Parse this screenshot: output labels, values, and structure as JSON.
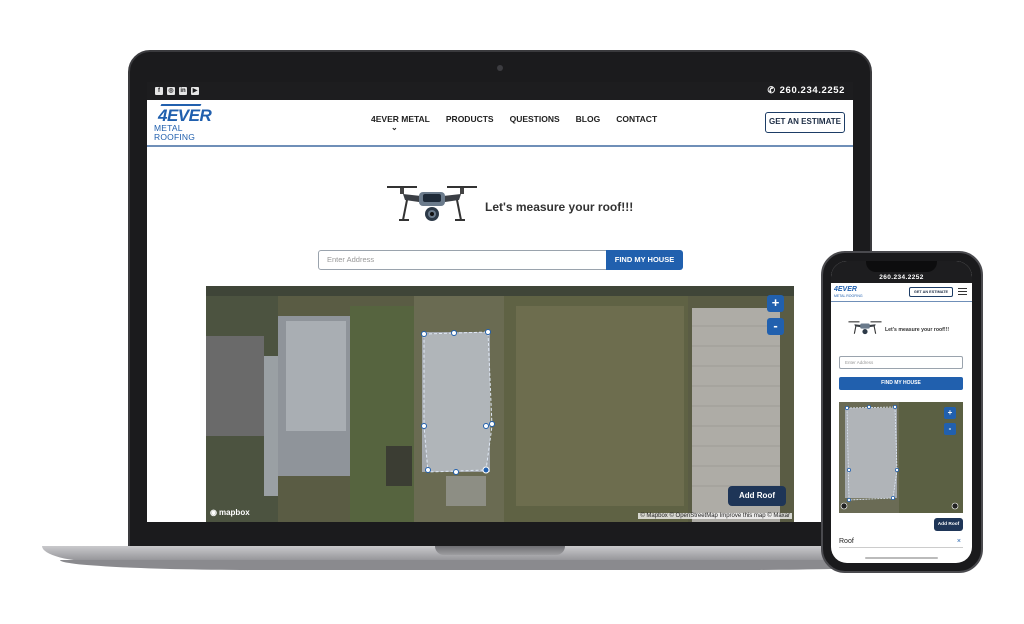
{
  "laptop": {
    "phone": "260.234.2252",
    "logo_main": "4EVER",
    "logo_sub": "METAL ROOFING",
    "nav": [
      "4EVER METAL",
      "PRODUCTS",
      "QUESTIONS",
      "BLOG",
      "CONTACT"
    ],
    "estimate_label": "GET AN ESTIMATE",
    "hero_title": "Let's measure your roof!!!",
    "address_placeholder": "Enter Address",
    "find_label": "FIND MY HOUSE",
    "zoom_in": "+",
    "zoom_out": "-",
    "add_roof_label": "Add Roof",
    "mapbox_label": "mapbox",
    "attribution": "© Mapbox © OpenStreetMap  Improve this map © Maxar"
  },
  "phone": {
    "phone": "260.234.2252",
    "logo_main": "4EVER",
    "logo_sub": "METAL ROOFING",
    "estimate_label": "GET AN ESTIMATE",
    "hero_title": "Let's measure your roof!!!",
    "address_placeholder": "Enter Address",
    "find_label": "FIND MY HOUSE",
    "zoom_in": "+",
    "zoom_out": "-",
    "add_roof_label": "Add Roof",
    "roof_row_label": "Roof",
    "roof_row_close": "×"
  },
  "colors": {
    "brand_blue": "#2160ae",
    "dark_navy": "#1e3557",
    "topbar": "#1d1d1f"
  }
}
